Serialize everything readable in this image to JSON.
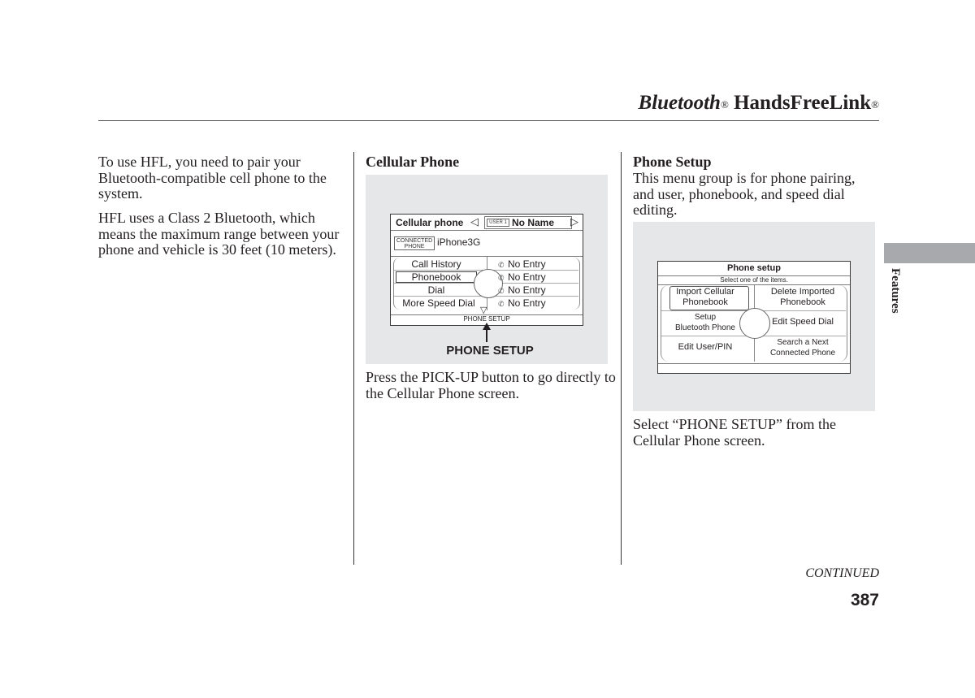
{
  "header": {
    "title_italic": "Bluetooth",
    "title_reg1": "®",
    "title_main": " HandsFreeLink",
    "title_reg2": "®"
  },
  "column1": {
    "paragraph1": "To use HFL, you need to pair your Bluetooth-compatible cell phone to the system.",
    "paragraph2": "HFL uses a Class 2 Bluetooth, which means the maximum range between your phone and vehicle is 30 feet (10 meters)."
  },
  "column2": {
    "heading": "Cellular Phone",
    "screen": {
      "title": "Cellular phone",
      "user_badge": "USER 1",
      "user_name": "No Name",
      "connected_label_line1": "CONNECTED",
      "connected_label_line2": "PHONE",
      "connected_phone": "iPhone3G",
      "menu_items": [
        "Call History",
        "Phonebook",
        "Dial",
        "More Speed Dial"
      ],
      "speed_dial_entries": [
        {
          "icon": "speed-dial-1-icon",
          "glyph": "✆",
          "label": "No Entry"
        },
        {
          "icon": "speed-dial-2-icon",
          "glyph": "✆",
          "label": "No Entry"
        },
        {
          "icon": "speed-dial-3-icon",
          "glyph": "✆",
          "label": "No Entry"
        },
        {
          "icon": "speed-dial-4-icon",
          "glyph": "✆",
          "label": "No Entry"
        }
      ],
      "footer_label": "PHONE SETUP",
      "selected_item": "Phonebook"
    },
    "callout_label": "PHONE SETUP",
    "caption": "Press the PICK-UP button to go directly to the Cellular Phone screen."
  },
  "column3": {
    "heading": "Phone Setup",
    "intro": "This menu group is for phone pairing, and user, phonebook, and speed dial editing.",
    "screen": {
      "title": "Phone setup",
      "subtitle": "Select one of the items.",
      "left_items": [
        {
          "line1": "Import Cellular",
          "line2": "Phonebook"
        },
        {
          "line1": "Setup",
          "line2": "Bluetooth Phone"
        },
        {
          "line1": "Edit User/PIN",
          "line2": ""
        }
      ],
      "right_items": [
        {
          "line1": "Delete Imported",
          "line2": "Phonebook"
        },
        {
          "line1": "Edit Speed Dial",
          "line2": ""
        },
        {
          "line1": "Search a Next",
          "line2": "Connected Phone"
        }
      ],
      "selected_item": "Import Cellular Phonebook"
    },
    "caption": "Select “PHONE SETUP” from the Cellular Phone screen."
  },
  "side_tab": {
    "label": "Features",
    "color": "#a7a9ac"
  },
  "footer": {
    "continued": "CONTINUED",
    "page_number": "387"
  }
}
